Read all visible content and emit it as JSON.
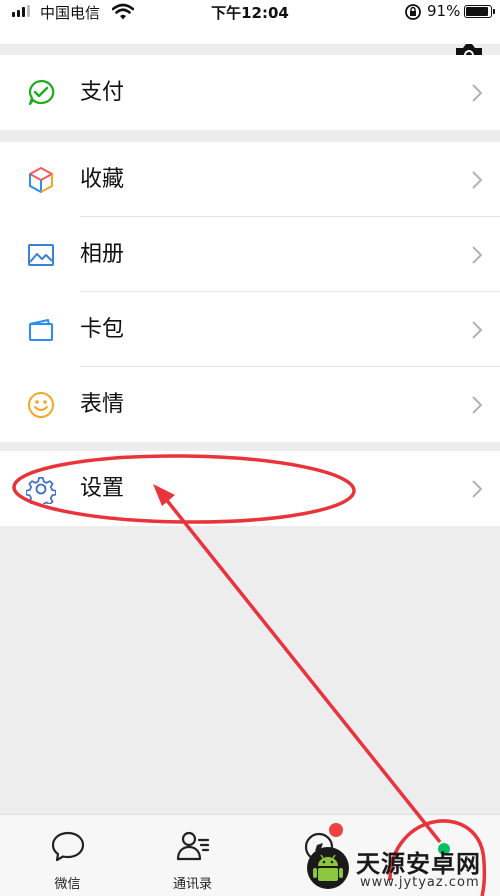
{
  "status_bar": {
    "carrier": "中国电信",
    "time": "下午12:04",
    "battery_percent": "91%",
    "battery_level": 0.91
  },
  "menu": {
    "pay": {
      "label": "支付",
      "icon": "wechat-pay-icon"
    },
    "favorites": {
      "label": "收藏",
      "icon": "cube-icon"
    },
    "album": {
      "label": "相册",
      "icon": "picture-icon"
    },
    "cards": {
      "label": "卡包",
      "icon": "card-wallet-icon"
    },
    "stickers": {
      "label": "表情",
      "icon": "smiley-icon"
    },
    "settings": {
      "label": "设置",
      "icon": "gear-icon"
    }
  },
  "tabbar": {
    "tabs": [
      {
        "label": "微信",
        "icon": "chat-bubble-icon"
      },
      {
        "label": "通讯录",
        "icon": "contacts-icon"
      },
      {
        "label": "",
        "icon": "discover-compass-icon"
      },
      {
        "label": "",
        "icon": "me-person-icon"
      }
    ]
  },
  "watermark": {
    "title": "天源安卓网",
    "url": "www.jytyaz.com"
  },
  "colors": {
    "annotation_red": "#e8343a",
    "accent_green": "#07c160",
    "pay_green": "#1aad19",
    "settings_blue": "#3b6ec9",
    "sticker_orange": "#f5a623",
    "badge_red": "#f04141",
    "background": "#ededed"
  }
}
